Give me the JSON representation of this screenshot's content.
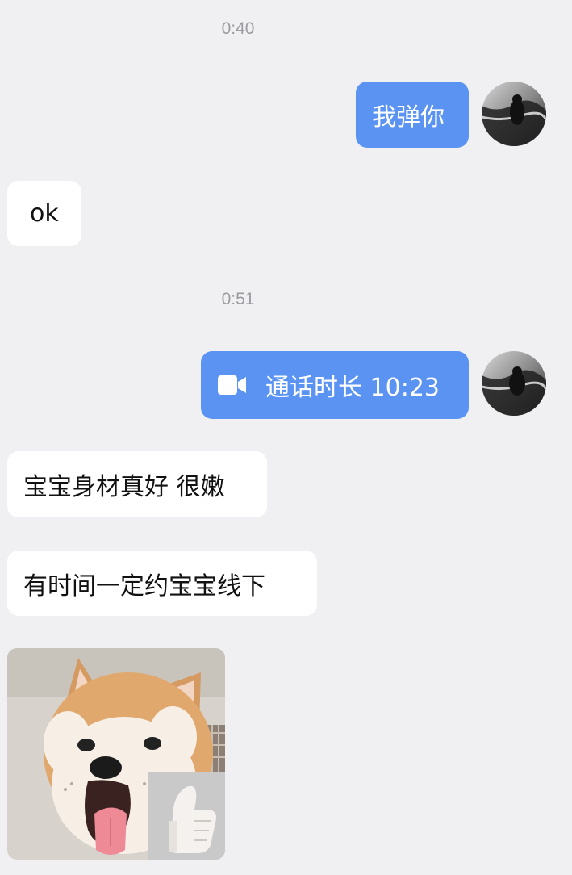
{
  "chat": {
    "timestamps": [
      "0:40",
      "0:51"
    ],
    "messages": [
      {
        "direction": "outgoing",
        "type": "text",
        "text": "我弹你"
      },
      {
        "direction": "incoming",
        "type": "text",
        "text": "ok"
      },
      {
        "direction": "outgoing",
        "type": "video-call",
        "icon": "video-camera-icon",
        "label": "通话时长 10:23"
      },
      {
        "direction": "incoming",
        "type": "text",
        "text": "宝宝身材真好 很嫩"
      },
      {
        "direction": "incoming",
        "type": "text",
        "text": "有时间一定约宝宝线下"
      },
      {
        "direction": "incoming",
        "type": "sticker",
        "icon": "shiba-dog-thumbs-up-sticker"
      }
    ]
  },
  "colors": {
    "background": "#f0f0f2",
    "outgoing_bubble": "#5b93f3",
    "incoming_bubble": "#ffffff",
    "timestamp_text": "#9a9a9f"
  }
}
